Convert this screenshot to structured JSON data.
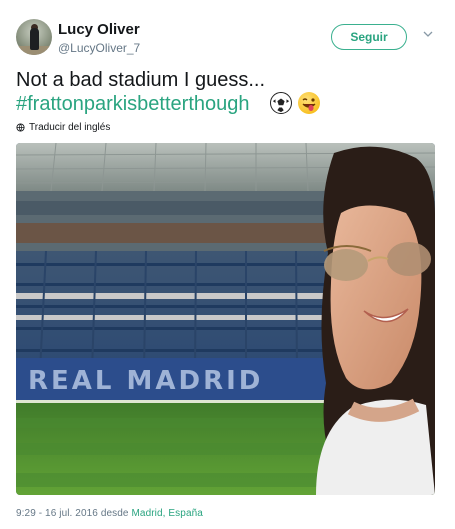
{
  "user": {
    "name": "Lucy Oliver",
    "handle": "@LucyOliver_7",
    "follow_label": "Seguir"
  },
  "tweet": {
    "line1": "Not a bad stadium I guess...",
    "hashtag": "#frattonparkisbetterthough",
    "emojis": [
      "soccer-ball",
      "winking-face-with-tongue"
    ],
    "translate_label": "Traducir del inglés",
    "photo_signage": "REAL MADRID"
  },
  "footer": {
    "timestamp": "9:29 - 16 jul. 2016 desde",
    "location": "Madrid, España"
  },
  "colors": {
    "accent": "#2aa480",
    "text": "#14171a",
    "muted": "#657786"
  },
  "icons": [
    "chevron-down-icon",
    "globe-icon"
  ]
}
